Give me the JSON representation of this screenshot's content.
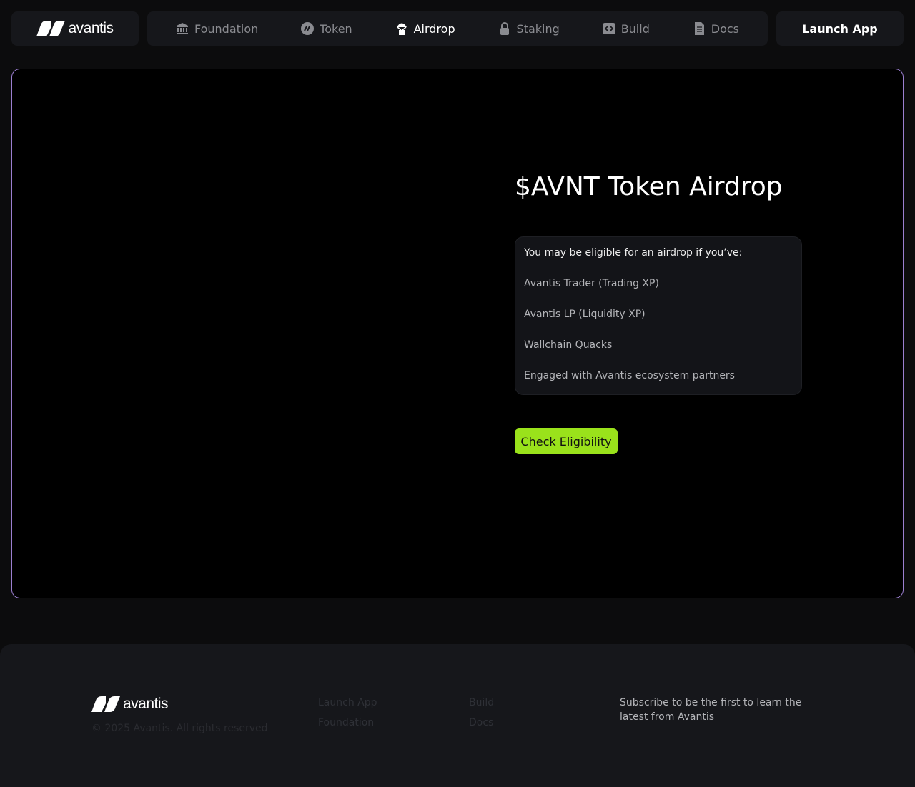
{
  "brand": {
    "name": "avantis"
  },
  "nav": {
    "items": [
      {
        "label": "Foundation",
        "icon": "bank-icon"
      },
      {
        "label": "Token",
        "icon": "token-icon"
      },
      {
        "label": "Airdrop",
        "icon": "airdrop-icon",
        "active": true
      },
      {
        "label": "Staking",
        "icon": "lock-icon"
      },
      {
        "label": "Build",
        "icon": "code-icon"
      },
      {
        "label": "Docs",
        "icon": "document-icon"
      }
    ],
    "launch": "Launch App"
  },
  "hero": {
    "title": "$AVNT Token Airdrop",
    "intro": "You may be eligible for an airdrop if you’ve:",
    "items": [
      "Avantis Trader (Trading XP)",
      "Avantis LP (Liquidity XP)",
      "Wallchain Quacks",
      "Engaged with Avantis ecosystem partners"
    ],
    "button": "Check Eligibility"
  },
  "footer": {
    "copyright": "© 2025 Avantis. All rights reserved",
    "col1": [
      "Launch App",
      "Foundation"
    ],
    "col2": [
      "Build",
      "Docs"
    ],
    "subscribe": "Subscribe to be the first to learn the latest from Avantis"
  },
  "colors": {
    "accent": "#9ae21b",
    "border": "#9b7fd0"
  }
}
